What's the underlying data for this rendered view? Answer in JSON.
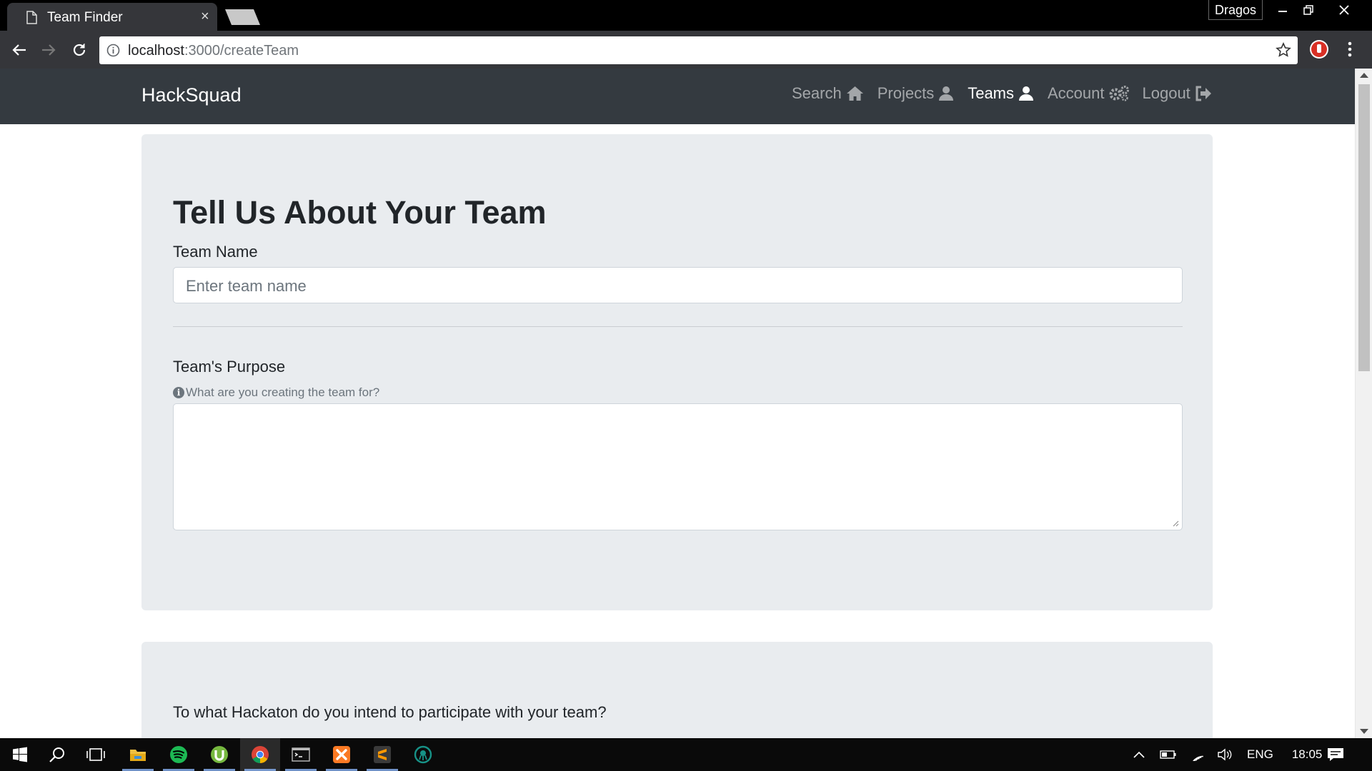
{
  "browser": {
    "tab_title": "Team Finder",
    "tab_close": "×",
    "profile_name": "Dragos",
    "url_host": "localhost",
    "url_path": ":3000/createTeam"
  },
  "site": {
    "brand": "HackSquad",
    "nav": [
      {
        "label": "Search",
        "icon": "home-icon",
        "active": false
      },
      {
        "label": "Projects",
        "icon": "user-icon",
        "active": false
      },
      {
        "label": "Teams",
        "icon": "user-icon",
        "active": true
      },
      {
        "label": "Account",
        "icon": "cogs-icon",
        "active": false
      },
      {
        "label": "Logout",
        "icon": "sign-out-icon",
        "active": false
      }
    ]
  },
  "form": {
    "title": "Tell Us About Your Team",
    "team_name_label": "Team Name",
    "team_name_placeholder": "Enter team name",
    "team_name_value": "",
    "purpose_label": "Team's Purpose",
    "purpose_help": "What are you creating the team for?",
    "purpose_value": "",
    "hackathon_label": "To what Hackaton do you intend to participate with your team?"
  },
  "taskbar": {
    "apps": [
      "start-icon",
      "search-icon",
      "task-view-icon",
      "file-explorer-icon",
      "spotify-icon",
      "utorrent-icon",
      "chrome-icon",
      "terminal-icon",
      "xampp-icon",
      "sublime-text-icon",
      "gitkraken-icon"
    ],
    "active_app": "chrome-icon",
    "language": "ENG",
    "time": "18:05"
  },
  "colors": {
    "navbar_bg": "#343a40",
    "jumbotron_bg": "#e9ecef",
    "browser_frame": "#35363a"
  }
}
